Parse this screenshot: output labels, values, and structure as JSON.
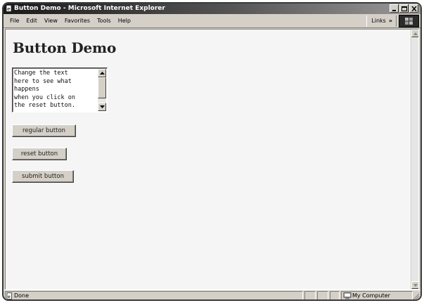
{
  "window": {
    "title": "Button Demo - Microsoft Internet Explorer",
    "controls": [
      "minimize",
      "maximize",
      "close"
    ]
  },
  "menubar": {
    "items": [
      "File",
      "Edit",
      "View",
      "Favorites",
      "Tools",
      "Help"
    ],
    "links_label": "Links",
    "links_chevron": "»"
  },
  "page": {
    "heading": "Button Demo",
    "textarea_value": "Change the text\nhere to see what\nhappens\nwhen you click on\nthe reset button.",
    "buttons": {
      "regular": "regular button",
      "reset": "reset button",
      "submit": "submit button"
    }
  },
  "statusbar": {
    "status": "Done",
    "zone": "My Computer"
  },
  "icons": {
    "app": "ie-page-icon",
    "throbber": "windows-logo-icon",
    "done": "page-icon",
    "zone": "computer-icon"
  },
  "colors": {
    "chrome": "#d4d0c8",
    "titlebar_start": "#1a1a1a",
    "titlebar_end": "#9a9a9a",
    "page_background": "#f5f5f5"
  }
}
